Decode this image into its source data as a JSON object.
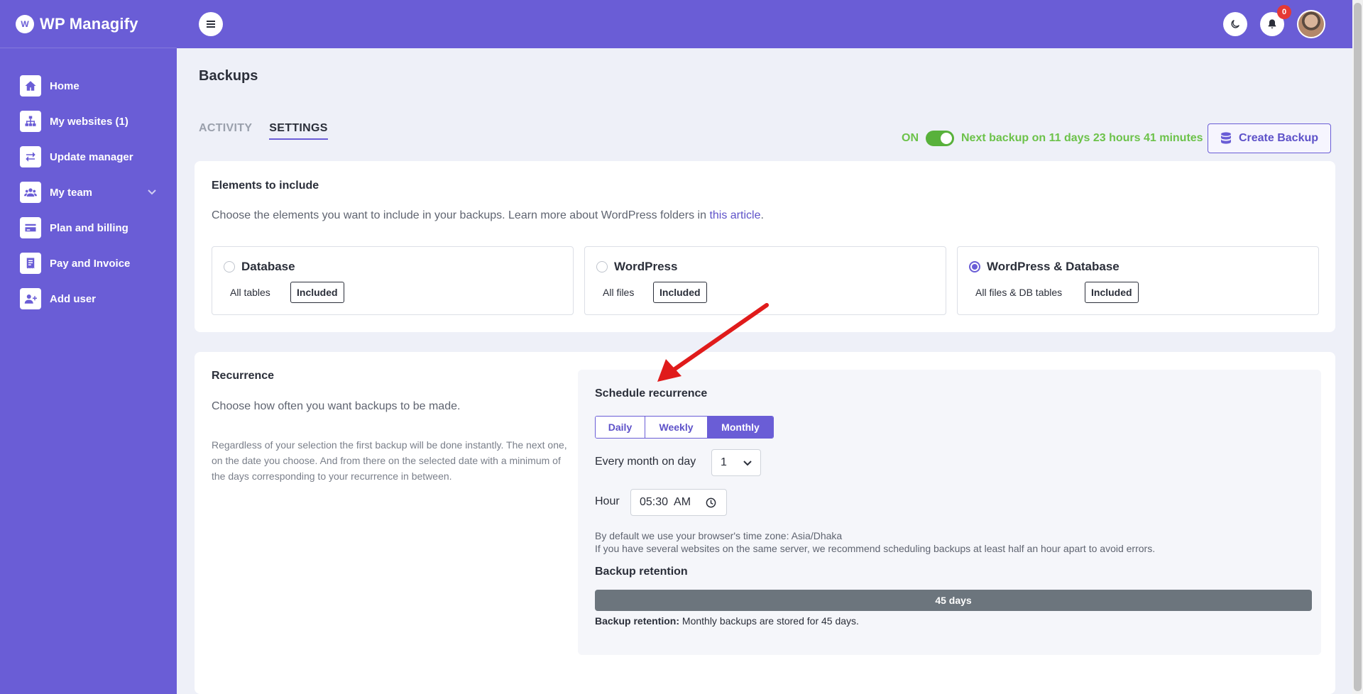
{
  "brand": {
    "name": "WP Managify",
    "mark": "W"
  },
  "sidebar": {
    "items": [
      {
        "label": "Home",
        "icon": "home-icon"
      },
      {
        "label": "My websites (1)",
        "icon": "sitemap-icon"
      },
      {
        "label": "Update manager",
        "icon": "arrows-exchange-icon"
      },
      {
        "label": "My team",
        "icon": "team-icon"
      },
      {
        "label": "Plan and billing",
        "icon": "credit-card-icon"
      },
      {
        "label": "Pay and Invoice",
        "icon": "receipt-icon"
      },
      {
        "label": "Add user",
        "icon": "user-plus-icon"
      }
    ]
  },
  "topbar": {
    "notification_count": "0"
  },
  "page": {
    "title": "Backups"
  },
  "tabs": [
    {
      "label": "ACTIVITY"
    },
    {
      "label": "SETTINGS"
    }
  ],
  "status": {
    "on_label": "ON",
    "enabled": true,
    "next_backup": "Next backup on 11 days 23 hours 41 minutes",
    "create_button": "Create Backup"
  },
  "elements": {
    "title": "Elements to include",
    "description": "Choose the elements you want to include in your backups. Learn more about WordPress folders in",
    "link_text": "this article",
    "link_suffix": ".",
    "options": [
      {
        "title": "Database",
        "sub": "All tables",
        "badge": "Included",
        "selected": false
      },
      {
        "title": "WordPress",
        "sub": "All files",
        "badge": "Included",
        "selected": false
      },
      {
        "title": "WordPress & Database",
        "sub": "All files & DB tables",
        "badge": "Included",
        "selected": true
      }
    ]
  },
  "recurrence": {
    "title": "Recurrence",
    "description": "Choose how often you want backups to be made.",
    "note": "Regardless of your selection the first backup will be done instantly. The next one, on the date you choose. And from there on the selected date with a minimum of the days corresponding to your recurrence in between."
  },
  "schedule": {
    "title": "Schedule recurrence",
    "frequencies": [
      "Daily",
      "Weekly",
      "Monthly"
    ],
    "active_frequency": "Monthly",
    "day_label": "Every month on day",
    "day_value": "1",
    "hour_label": "Hour",
    "hour_value": "05:30  AM",
    "timezone_hint": "By default we use your browser's time zone: Asia/Dhaka",
    "server_hint": "If you have several websites on the same server, we recommend scheduling backups at least half an hour apart to avoid errors.",
    "retention_title": "Backup retention",
    "retention_value": "45 days",
    "retention_note_label": "Backup retention:",
    "retention_note_text": " Monthly backups are stored for 45 days."
  },
  "colors": {
    "brand": "#6a5dd6",
    "status_green": "#6cc24a",
    "annotation": "#e01b1b"
  }
}
